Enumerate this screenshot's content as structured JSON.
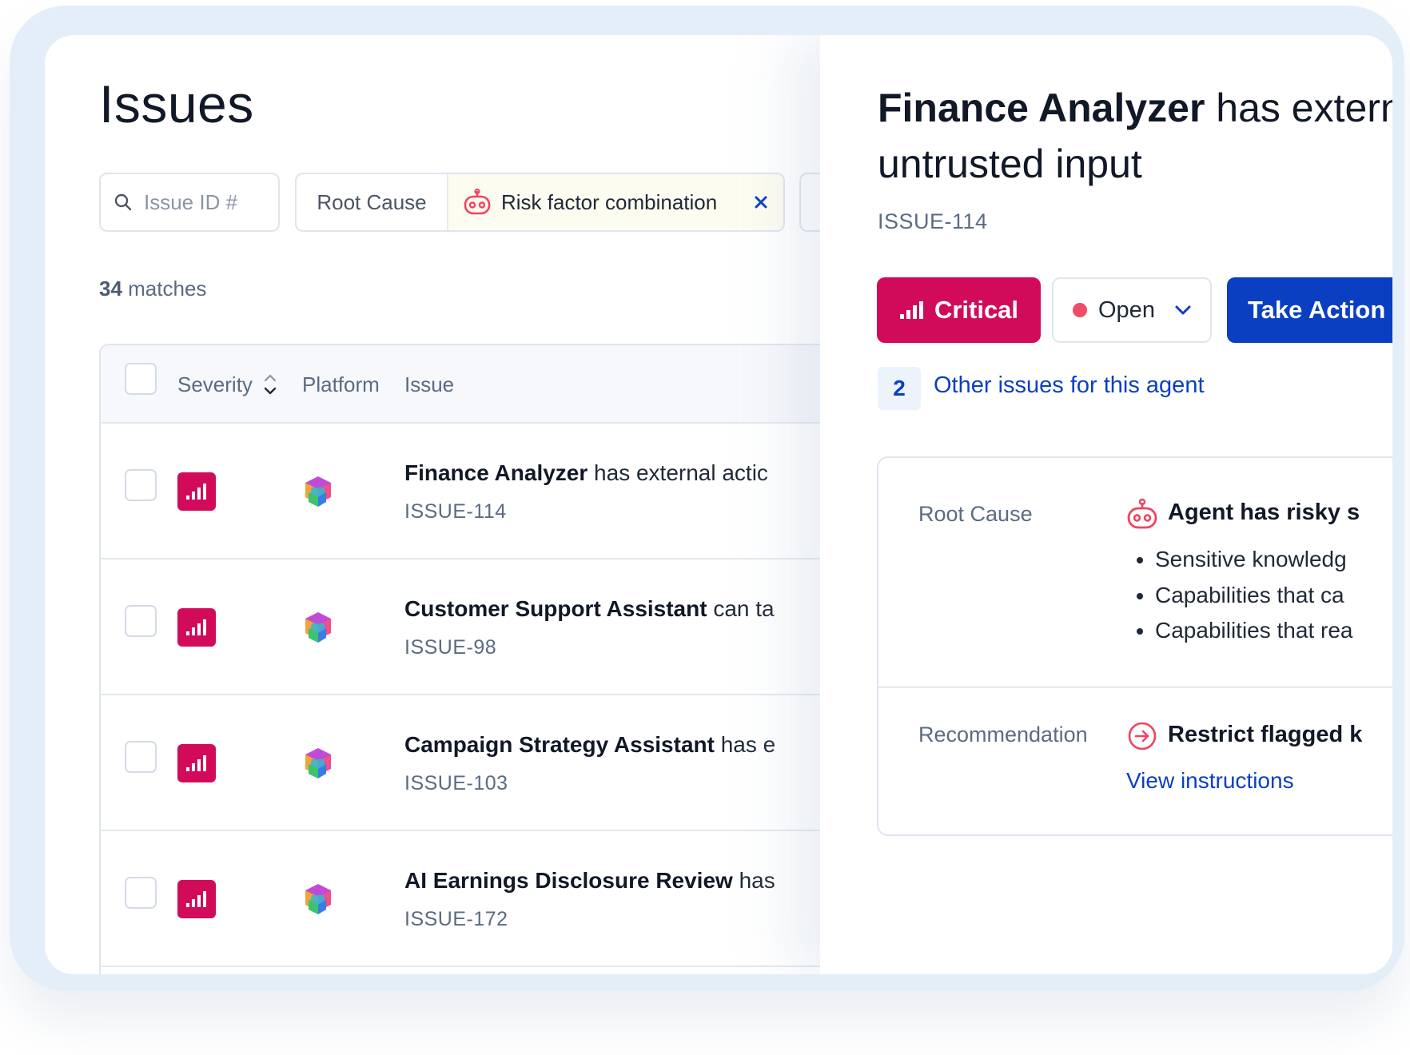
{
  "page": {
    "title": "Issues"
  },
  "filters": {
    "search_placeholder": "Issue ID #",
    "root_cause_label": "Root Cause",
    "root_cause_value": "Risk factor combination"
  },
  "results": {
    "count": "34",
    "suffix": " matches"
  },
  "table": {
    "columns": {
      "severity": "Severity",
      "platform": "Platform",
      "issue": "Issue"
    },
    "rows": [
      {
        "agent": "Finance Analyzer",
        "rest": " has external actic",
        "id": "ISSUE-114"
      },
      {
        "agent": "Customer Support Assistant",
        "rest": " can ta",
        "id": "ISSUE-98"
      },
      {
        "agent": "Campaign Strategy Assistant",
        "rest": " has e",
        "id": "ISSUE-103"
      },
      {
        "agent": "AI Earnings Disclosure Review",
        "rest": " has",
        "id": "ISSUE-172"
      }
    ]
  },
  "detail": {
    "agent": "Finance Analyzer",
    "title_rest": " has externa untrusted input",
    "issue_id": "ISSUE-114",
    "severity_label": "Critical",
    "status_label": "Open",
    "action_label": "Take Action",
    "other_issues_count": "2",
    "other_issues_label": "Other issues for this agent",
    "root_cause": {
      "label": "Root Cause",
      "heading": "Agent has risky s",
      "items": [
        "Sensitive knowledg",
        "Capabilities that ca",
        "Capabilities that rea"
      ]
    },
    "recommendation": {
      "label": "Recommendation",
      "heading": "Restrict flagged k",
      "link": "View instructions"
    }
  },
  "colors": {
    "critical": "#d10b5a",
    "primary": "#0a3fc2",
    "status_open": "#f04b67",
    "frame": "#e4eef8"
  },
  "icons": {
    "search": "search-icon",
    "robot": "robot-icon",
    "close": "close-icon",
    "sort": "sort-icon",
    "signal": "signal-bars-icon",
    "platform": "cube-logo-icon",
    "chevron": "chevron-down-icon",
    "arrow": "arrow-right-circle-icon"
  }
}
